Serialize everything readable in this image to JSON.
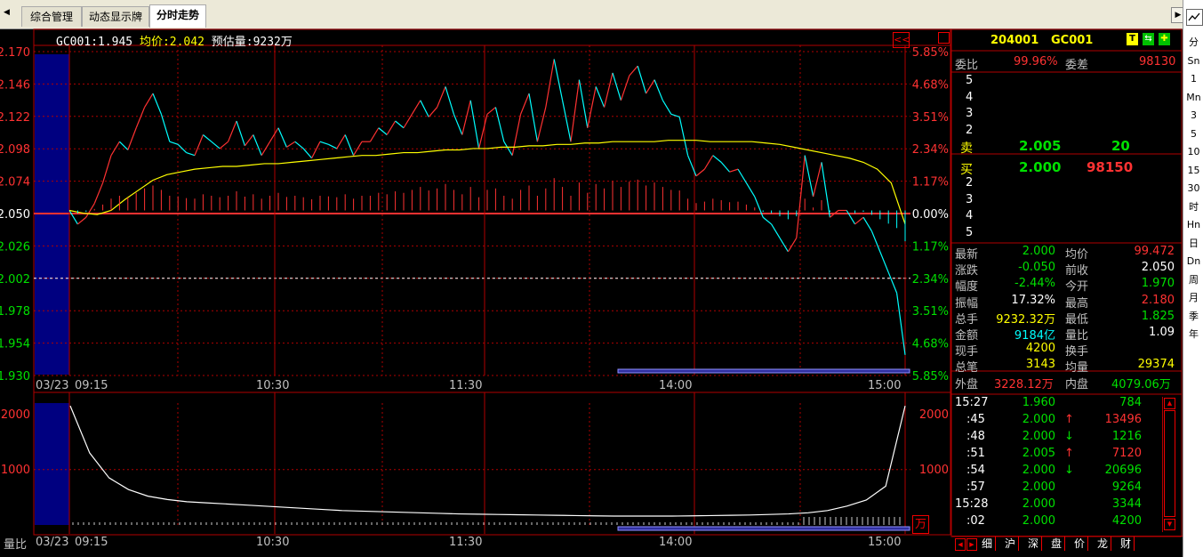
{
  "colors": {
    "up": "#ff3232",
    "down": "#00e000",
    "price_line": "#ffffff",
    "avg_line": "#ffff00",
    "grid": "#b00000",
    "cyan": "#00ffff",
    "navy": "#000080",
    "yellow": "#ffff00"
  },
  "tabs": [
    {
      "label": "综合管理"
    },
    {
      "label": "动态显示牌"
    },
    {
      "label": "分时走势"
    }
  ],
  "right_toolbar": [
    "分",
    "Sn",
    "1",
    "Mn",
    "3",
    "5",
    "10",
    "15",
    "30",
    "时",
    "Hn",
    "日",
    "Dn",
    "周",
    "月",
    "季",
    "年"
  ],
  "chart_header": {
    "code_label": "GC001:",
    "price": "1.945",
    "avg_label": "均价:",
    "avg": "2.042",
    "est_label": "预估量:",
    "est": "9232万"
  },
  "chart_data": [
    {
      "type": "line",
      "title": "",
      "y_ticks_left": [
        "2.170",
        "2.146",
        "2.122",
        "2.098",
        "2.074",
        "2.050",
        "2.026",
        "2.002",
        "1.978",
        "1.954",
        "1.930"
      ],
      "y_ticks_right": [
        "5.85%",
        "4.68%",
        "3.51%",
        "2.34%",
        "1.17%",
        "0.00%",
        "1.17%",
        "2.34%",
        "3.51%",
        "4.68%",
        "5.85%"
      ],
      "x_ticks": [
        "03/23",
        "09:15",
        "10:30",
        "11:30",
        "14:00",
        "15:00"
      ],
      "ylim": [
        1.93,
        2.17
      ],
      "prev_close": 2.05,
      "series": [
        {
          "values": [
            2.05,
            2.04,
            2.045,
            2.055,
            2.07,
            2.09,
            2.1,
            2.094,
            2.11,
            2.125,
            2.135,
            2.12,
            2.1,
            2.098,
            2.092,
            2.09,
            2.105,
            2.1,
            2.095,
            2.1,
            2.115,
            2.097,
            2.105,
            2.09,
            2.1,
            2.11,
            2.096,
            2.1,
            2.095,
            2.088,
            2.1,
            2.098,
            2.095,
            2.105,
            2.09,
            2.1,
            2.1,
            2.11,
            2.105,
            2.115,
            2.11,
            2.12,
            2.13,
            2.118,
            2.125,
            2.14,
            2.12,
            2.105,
            2.13,
            2.095,
            2.12,
            2.125,
            2.1,
            2.09,
            2.12,
            2.135,
            2.1,
            2.125,
            2.16,
            2.13,
            2.1,
            2.145,
            2.11,
            2.14,
            2.125,
            2.15,
            2.13,
            2.148,
            2.155,
            2.135,
            2.145,
            2.13,
            2.12,
            2.118,
            2.09,
            2.075,
            2.08,
            2.09,
            2.085,
            2.078,
            2.08,
            2.07,
            2.06,
            2.045,
            2.04,
            2.03,
            2.02,
            2.03,
            2.09,
            2.06,
            2.085,
            2.045,
            2.05,
            2.05,
            2.04,
            2.045,
            2.035,
            2.02,
            2.005,
            1.99,
            1.945
          ]
        },
        {
          "values": [
            2.05,
            2.048,
            2.047,
            2.05,
            2.058,
            2.065,
            2.072,
            2.076,
            2.078,
            2.08,
            2.081,
            2.082,
            2.082,
            2.083,
            2.084,
            2.084,
            2.085,
            2.086,
            2.087,
            2.088,
            2.089,
            2.09,
            2.09,
            2.091,
            2.092,
            2.092,
            2.093,
            2.094,
            2.094,
            2.095,
            2.095,
            2.096,
            2.096,
            2.097,
            2.097,
            2.098,
            2.098,
            2.099,
            2.099,
            2.1,
            2.1,
            2.1,
            2.1,
            2.101,
            2.101,
            2.101,
            2.1,
            2.1,
            2.1,
            2.1,
            2.099,
            2.098,
            2.096,
            2.094,
            2.092,
            2.09,
            2.088,
            2.085,
            2.08,
            2.07,
            2.04
          ]
        }
      ]
    },
    {
      "type": "area",
      "title": "",
      "y_ticks": [
        "2000",
        "1000"
      ],
      "y_label": "量比",
      "unit": "万",
      "x_ticks": [
        "03/23",
        "09:15",
        "10:30",
        "11:30",
        "14:00",
        "15:00"
      ],
      "ylim": [
        0,
        2200
      ],
      "series": [
        {
          "values": [
            2150,
            1300,
            850,
            640,
            520,
            460,
            420,
            400,
            380,
            360,
            340,
            320,
            300,
            280,
            260,
            250,
            240,
            230,
            220,
            210,
            200,
            195,
            190,
            185,
            180,
            175,
            170,
            165,
            160,
            160,
            160,
            160,
            165,
            170,
            175,
            180,
            190,
            200,
            220,
            260,
            340,
            450,
            700,
            2150
          ]
        }
      ]
    }
  ],
  "quote": {
    "code1": "204001",
    "code2": "GC001",
    "icons": [
      "T",
      "⇆",
      "✚"
    ],
    "wei_bi_label": "委比",
    "wei_bi": "99.96%",
    "wei_cha_label": "委差",
    "wei_cha": "98130",
    "sell_levels": [
      "5",
      "4",
      "3",
      "2"
    ],
    "sell_label": "卖",
    "sell_price": "2.005",
    "sell_vol": "20",
    "buy_label": "买",
    "buy_price": "2.000",
    "buy_vol": "98150",
    "buy_levels": [
      "2",
      "3",
      "4",
      "5"
    ],
    "rows": [
      {
        "l1": "最新",
        "v1": "2.000",
        "l2": "均价",
        "v2": "99.472"
      },
      {
        "l1": "涨跌",
        "v1": "-0.050",
        "l2": "前收",
        "v2": "2.050"
      },
      {
        "l1": "幅度",
        "v1": "-2.44%",
        "l2": "今开",
        "v2": "1.970"
      },
      {
        "l1": "振幅",
        "v1": "17.32%",
        "l2": "最高",
        "v2": "2.180"
      },
      {
        "l1": "总手",
        "v1": "9232.32万",
        "l2": "最低",
        "v2": "1.825"
      },
      {
        "l1": "金额",
        "v1": "9184亿",
        "l2": "量比",
        "v2": "1.09"
      },
      {
        "l1": "现手",
        "v1": "4200",
        "l2": "换手",
        "v2": ""
      },
      {
        "l1": "总笔",
        "v1": "3143",
        "l2": "均量",
        "v2": "29374"
      }
    ],
    "wai_label": "外盘",
    "wai": "3228.12万",
    "nei_label": "内盘",
    "nei": "4079.06万"
  },
  "ticks": [
    {
      "time": "15:27",
      "price": "1.960",
      "arrow": "",
      "vol": "784"
    },
    {
      "time": ":45",
      "price": "2.000",
      "arrow": "↑",
      "vol": "13496"
    },
    {
      "time": ":48",
      "price": "2.000",
      "arrow": "↓",
      "vol": "1216"
    },
    {
      "time": ":51",
      "price": "2.005",
      "arrow": "↑",
      "vol": "7120"
    },
    {
      "time": ":54",
      "price": "2.000",
      "arrow": "↓",
      "vol": "20696"
    },
    {
      "time": ":57",
      "price": "2.000",
      "arrow": "",
      "vol": "9264"
    },
    {
      "time": "15:28",
      "price": "2.000",
      "arrow": "",
      "vol": "3344"
    },
    {
      "time": ":02",
      "price": "2.000",
      "arrow": "",
      "vol": "4200"
    }
  ],
  "bottom_tabs": [
    "细",
    "沪",
    "深",
    "盘",
    "价",
    "龙",
    "财"
  ]
}
